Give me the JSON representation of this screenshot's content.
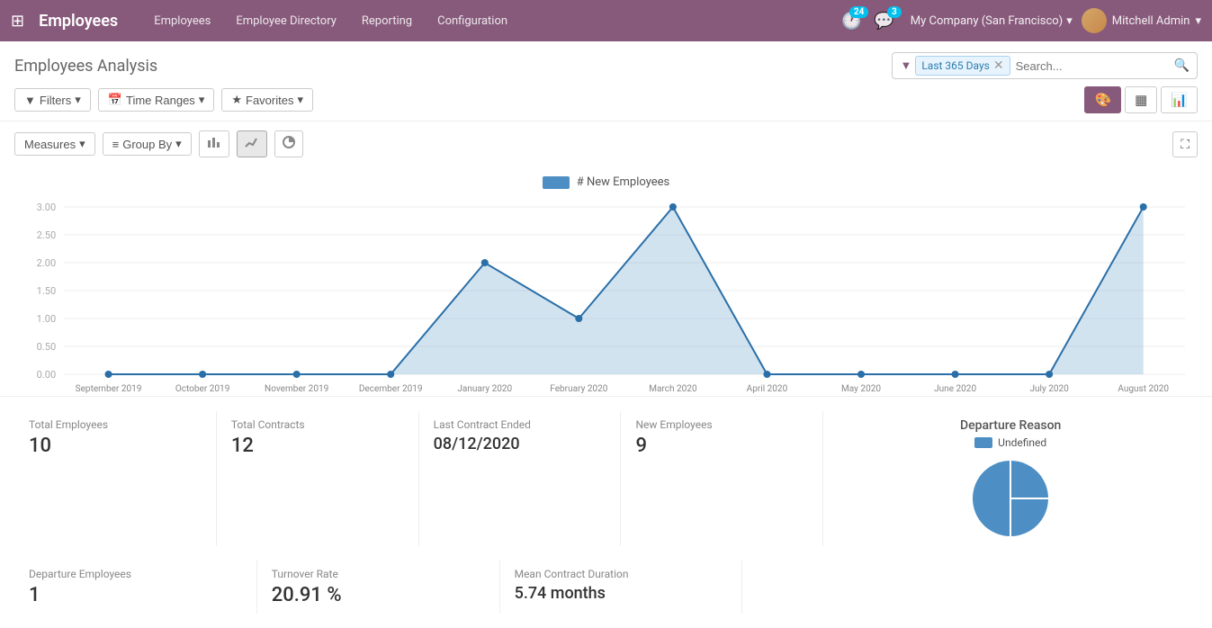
{
  "app": {
    "title": "Employees",
    "grid_icon": "⊞"
  },
  "nav": {
    "items": [
      {
        "label": "Employees",
        "active": false
      },
      {
        "label": "Employee Directory",
        "active": false
      },
      {
        "label": "Reporting",
        "active": false
      },
      {
        "label": "Configuration",
        "active": false
      }
    ]
  },
  "topbar": {
    "notifications_count": "24",
    "messages_count": "3",
    "company": "My Company (San Francisco)",
    "user": "Mitchell Admin"
  },
  "page": {
    "title": "Employees Analysis"
  },
  "search": {
    "filter_label": "Last 365 Days",
    "placeholder": "Search..."
  },
  "toolbar": {
    "filters_label": "Filters",
    "time_ranges_label": "Time Ranges",
    "favorites_label": "Favorites"
  },
  "graph_controls": {
    "measures_label": "Measures",
    "group_by_label": "Group By"
  },
  "chart": {
    "legend_label": "# New Employees",
    "x_labels": [
      "September 2019",
      "October 2019",
      "November 2019",
      "December 2019",
      "January 2020",
      "February 2020",
      "March 2020",
      "April 2020",
      "May 2020",
      "June 2020",
      "July 2020",
      "August 2020"
    ],
    "y_labels": [
      "3.00",
      "2.50",
      "2.00",
      "1.50",
      "1.00",
      "0.50",
      "0.00"
    ],
    "data_points": [
      0,
      0,
      0,
      0,
      2,
      1,
      3,
      0,
      0,
      0,
      0,
      3
    ]
  },
  "stats": {
    "total_employees_label": "Total Employees",
    "total_employees_value": "10",
    "total_contracts_label": "Total Contracts",
    "total_contracts_value": "12",
    "last_contract_ended_label": "Last Contract Ended",
    "last_contract_ended_value": "08/12/2020",
    "new_employees_label": "New Employees",
    "new_employees_value": "9",
    "departure_reason_label": "Departure Reason",
    "departure_reason_legend": "Undefined",
    "departure_employees_label": "Departure Employees",
    "departure_employees_value": "1",
    "turnover_rate_label": "Turnover Rate",
    "turnover_rate_value": "20.91 %",
    "mean_contract_label": "Mean Contract Duration",
    "mean_contract_value": "5.74 months"
  },
  "colors": {
    "primary": "#875a7b",
    "chart_fill": "#4d8fc4",
    "chart_stroke": "#2a6fa8",
    "chart_area": "rgba(77,143,196,0.3)"
  }
}
